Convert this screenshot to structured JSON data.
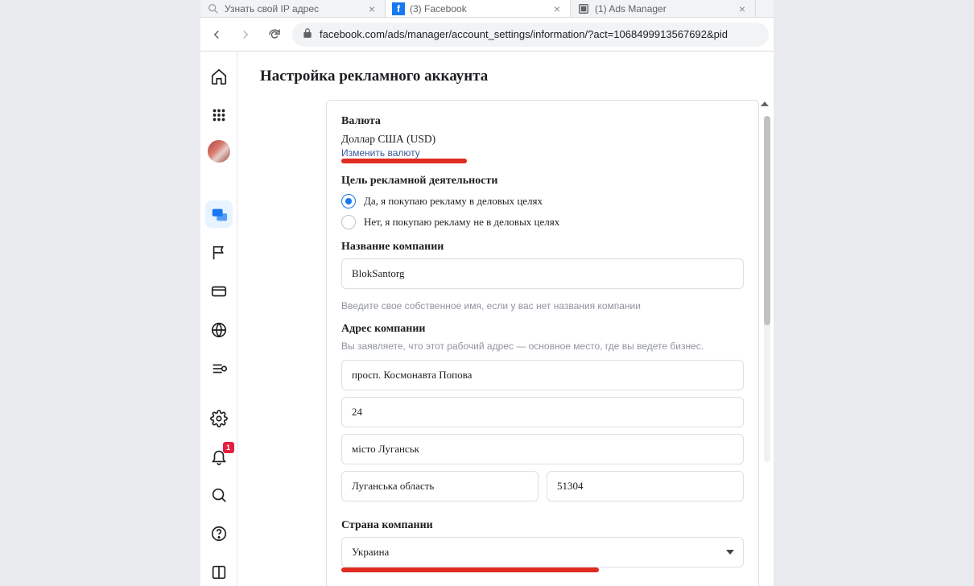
{
  "tabs": [
    {
      "title": "Узнать свой IP адрес",
      "icon": "search"
    },
    {
      "title": "(3) Facebook",
      "icon": "fb"
    },
    {
      "title": "(1) Ads Manager",
      "icon": "ads"
    }
  ],
  "url": "facebook.com/ads/manager/account_settings/information/?act=1068499913567692&pid",
  "page": {
    "title": "Настройка рекламного аккаунта"
  },
  "sidebar": {
    "notif_count": "1"
  },
  "currency": {
    "heading": "Валюта",
    "value": "Доллар США (USD)",
    "change_link": "Изменить валюту"
  },
  "purpose": {
    "heading": "Цель рекламной деятельности",
    "option_yes": "Да, я покупаю рекламу в деловых целях",
    "option_no": "Нет, я покупаю рекламу не в деловых целях"
  },
  "company_name": {
    "heading": "Название компании",
    "value": "BlokSantorg",
    "hint": "Введите свое собственное имя, если у вас нет названия компании"
  },
  "company_address": {
    "heading": "Адрес компании",
    "subtext": "Вы заявляете, что этот рабочий адрес — основное место, где вы ведете бизнес.",
    "street": "просп. Космонавта Попова",
    "street2": "24",
    "city": "місто Луганськ",
    "region": "Луганська область",
    "zip": "51304"
  },
  "company_country": {
    "heading": "Страна компании",
    "value": "Украина"
  }
}
